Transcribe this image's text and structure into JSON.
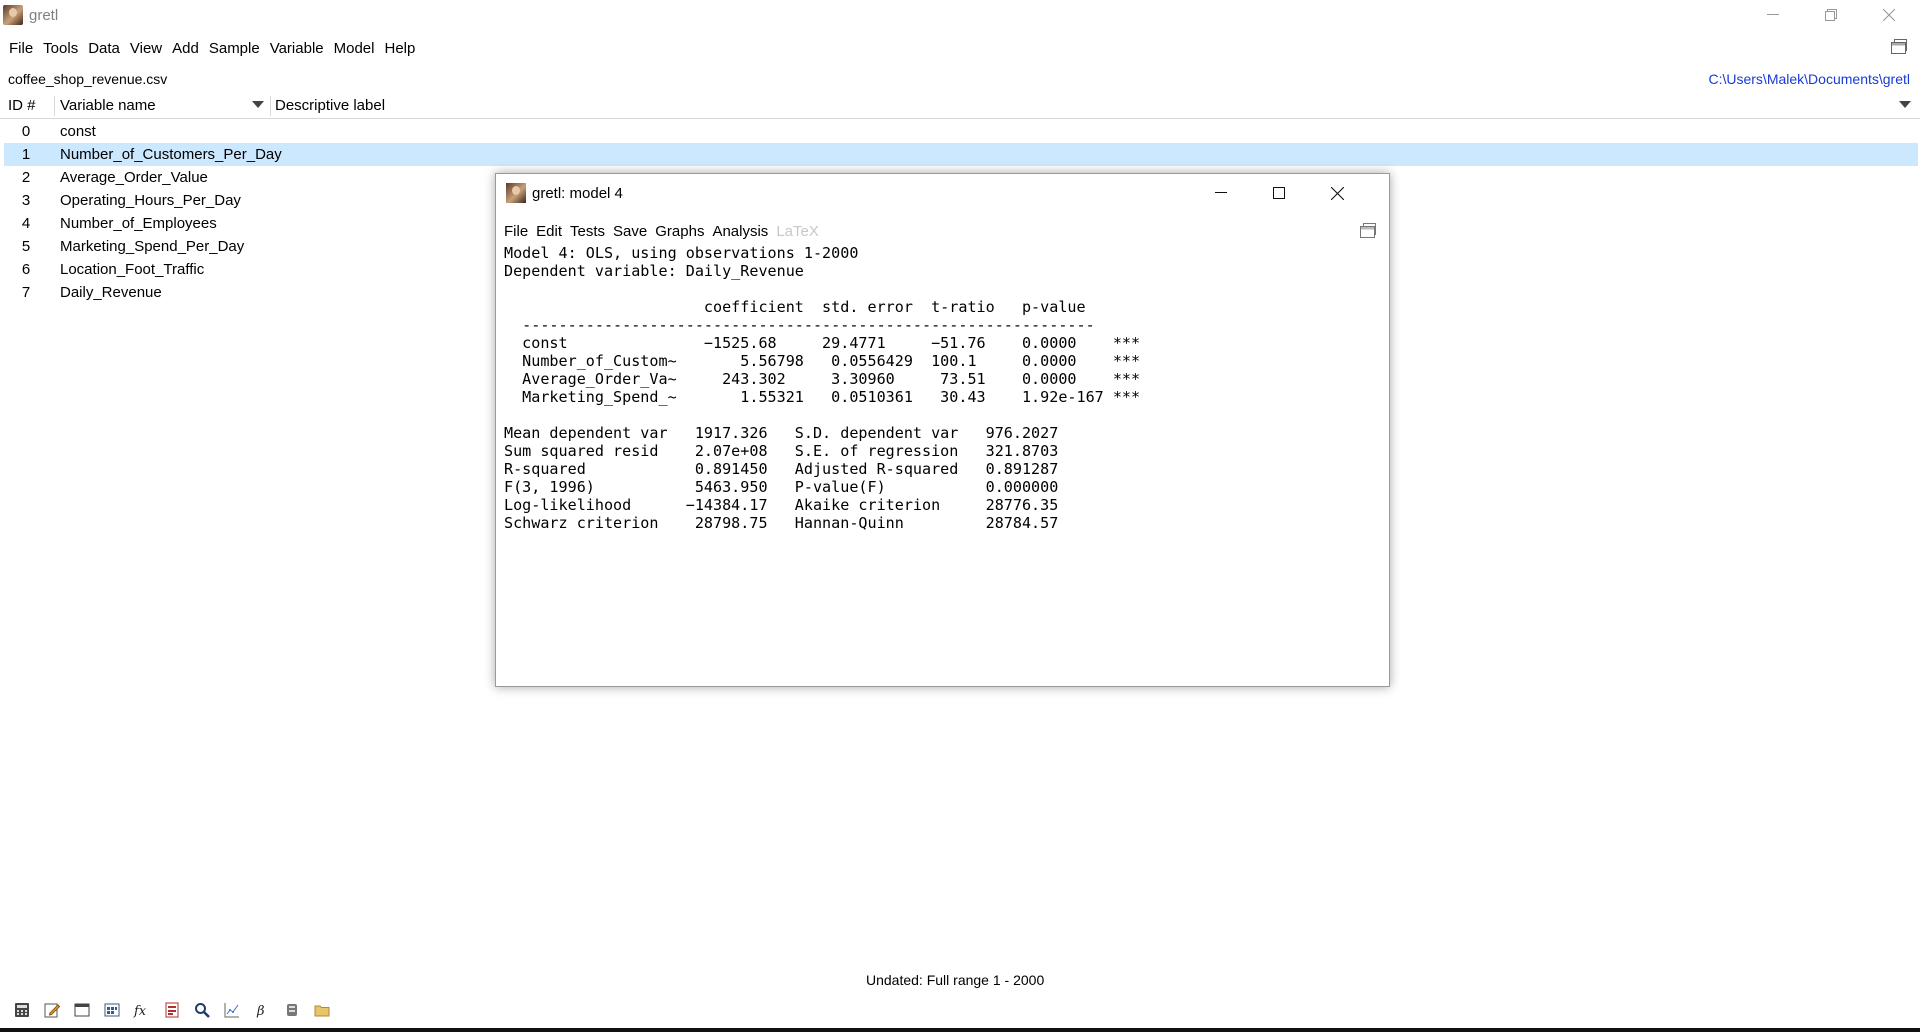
{
  "app": {
    "title": "gretl"
  },
  "menu": [
    "File",
    "Tools",
    "Data",
    "View",
    "Add",
    "Sample",
    "Variable",
    "Model",
    "Help"
  ],
  "dataset": {
    "filename": "coffee_shop_revenue.csv",
    "path": "C:\\Users\\Malek\\Documents\\gretl"
  },
  "columns": {
    "id": "ID #",
    "name": "Variable name",
    "label": "Descriptive label"
  },
  "variables": [
    {
      "id": "0",
      "name": "const"
    },
    {
      "id": "1",
      "name": "Number_of_Customers_Per_Day"
    },
    {
      "id": "2",
      "name": "Average_Order_Value"
    },
    {
      "id": "3",
      "name": "Operating_Hours_Per_Day"
    },
    {
      "id": "4",
      "name": "Number_of_Employees"
    },
    {
      "id": "5",
      "name": "Marketing_Spend_Per_Day"
    },
    {
      "id": "6",
      "name": "Location_Foot_Traffic"
    },
    {
      "id": "7",
      "name": "Daily_Revenue"
    }
  ],
  "selected_variable_index": 1,
  "model_window": {
    "title": "gretl: model 4",
    "menu": [
      "File",
      "Edit",
      "Tests",
      "Save",
      "Graphs",
      "Analysis"
    ],
    "menu_disabled": "LaTeX",
    "output": "Model 4: OLS, using observations 1-2000\nDependent variable: Daily_Revenue\n\n                      coefficient  std. error  t-ratio   p-value\n  ---------------------------------------------------------------\n  const               −1525.68     29.4771     −51.76    0.0000    ***\n  Number_of_Custom~       5.56798   0.0556429  100.1     0.0000    ***\n  Average_Order_Va~     243.302     3.30960     73.51    0.0000    ***\n  Marketing_Spend_~       1.55321   0.0510361   30.43    1.92e-167 ***\n\nMean dependent var   1917.326   S.D. dependent var   976.2027\nSum squared resid    2.07e+08   S.E. of regression   321.8703\nR-squared            0.891450   Adjusted R-squared   0.891287\nF(3, 1996)           5463.950   P-value(F)           0.000000\nLog-likelihood      −14384.17   Akaike criterion     28776.35\nSchwarz criterion    28798.75   Hannan-Quinn         28784.57"
  },
  "status": "Undated: Full range 1 - 2000",
  "toolbar_icons": [
    "calculator-icon",
    "edit-icon",
    "terminal-icon",
    "session-icon",
    "function-icon",
    "help-icon",
    "search-icon",
    "graph-icon",
    "beta-icon",
    "database-icon",
    "folder-icon"
  ]
}
